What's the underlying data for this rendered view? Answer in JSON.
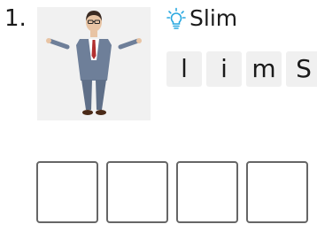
{
  "question": {
    "number": "1."
  },
  "picture": {
    "icon": "man-standing-arms-out-illustration"
  },
  "hint": {
    "icon": "lightbulb-icon",
    "icon_color": "#29a8e0",
    "word": "Slim"
  },
  "tiles": [
    {
      "letter": "l"
    },
    {
      "letter": "i"
    },
    {
      "letter": "m"
    },
    {
      "letter": "S"
    }
  ],
  "answer_slots": [
    {
      "letter": ""
    },
    {
      "letter": ""
    },
    {
      "letter": ""
    },
    {
      "letter": ""
    }
  ]
}
